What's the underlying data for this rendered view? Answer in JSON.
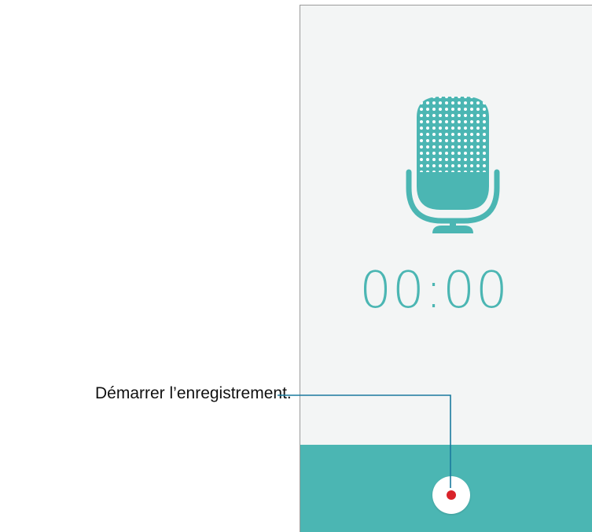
{
  "recorder": {
    "timer": "00:00",
    "accent_color": "#4bb6b3",
    "record_dot_color": "#d9232a",
    "icon": "microphone-icon"
  },
  "callout": {
    "label": "Démarrer l’enregistrement."
  }
}
